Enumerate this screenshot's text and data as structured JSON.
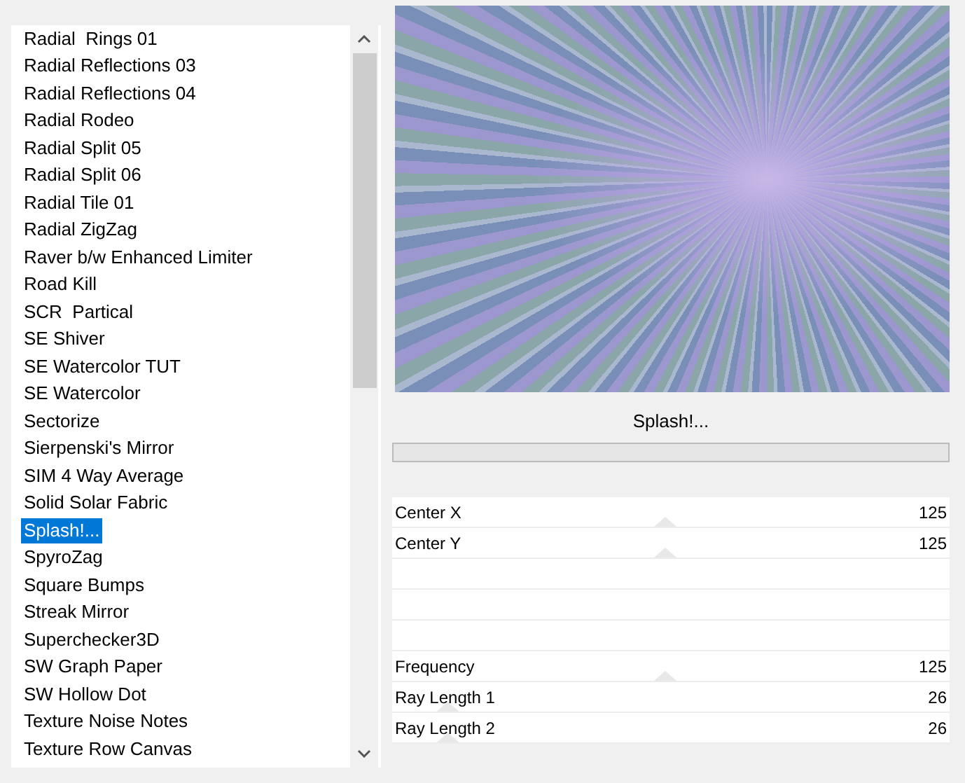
{
  "filter_list": {
    "items": [
      {
        "label": "Radial  Rings 01",
        "selected": false
      },
      {
        "label": "Radial Reflections 03",
        "selected": false
      },
      {
        "label": "Radial Reflections 04",
        "selected": false
      },
      {
        "label": "Radial Rodeo",
        "selected": false
      },
      {
        "label": "Radial Split 05",
        "selected": false
      },
      {
        "label": "Radial Split 06",
        "selected": false
      },
      {
        "label": "Radial Tile 01",
        "selected": false
      },
      {
        "label": "Radial ZigZag",
        "selected": false
      },
      {
        "label": "Raver b/w Enhanced Limiter",
        "selected": false
      },
      {
        "label": "Road Kill",
        "selected": false
      },
      {
        "label": "SCR  Partical",
        "selected": false
      },
      {
        "label": "SE Shiver",
        "selected": false
      },
      {
        "label": "SE Watercolor TUT",
        "selected": false
      },
      {
        "label": "SE Watercolor",
        "selected": false
      },
      {
        "label": "Sectorize",
        "selected": false
      },
      {
        "label": "Sierpenski's Mirror",
        "selected": false
      },
      {
        "label": "SIM 4 Way Average",
        "selected": false
      },
      {
        "label": "Solid Solar Fabric",
        "selected": false
      },
      {
        "label": "Splash!...",
        "selected": true
      },
      {
        "label": "SpyroZag",
        "selected": false
      },
      {
        "label": "Square Bumps",
        "selected": false
      },
      {
        "label": "Streak Mirror",
        "selected": false
      },
      {
        "label": "Superchecker3D",
        "selected": false
      },
      {
        "label": "SW Graph Paper",
        "selected": false
      },
      {
        "label": "SW Hollow Dot",
        "selected": false
      },
      {
        "label": "Texture Noise Notes",
        "selected": false
      },
      {
        "label": "Texture Row Canvas",
        "selected": false
      }
    ]
  },
  "filter_title": "Splash!...",
  "progress": {
    "level": 0
  },
  "controls": [
    {
      "kind": "slider",
      "label": "Center X",
      "value": "125",
      "level": 0.49
    },
    {
      "kind": "slider",
      "label": "Center Y",
      "value": "125",
      "level": 0.49
    },
    {
      "kind": "empty"
    },
    {
      "kind": "empty"
    },
    {
      "kind": "empty"
    },
    {
      "kind": "slider",
      "label": "Frequency",
      "value": "125",
      "level": 0.49
    },
    {
      "kind": "slider",
      "label": "Ray Length 1",
      "value": "26",
      "level": 0.1
    },
    {
      "kind": "slider",
      "label": "Ray Length 2",
      "value": "26",
      "level": 0.1
    }
  ]
}
